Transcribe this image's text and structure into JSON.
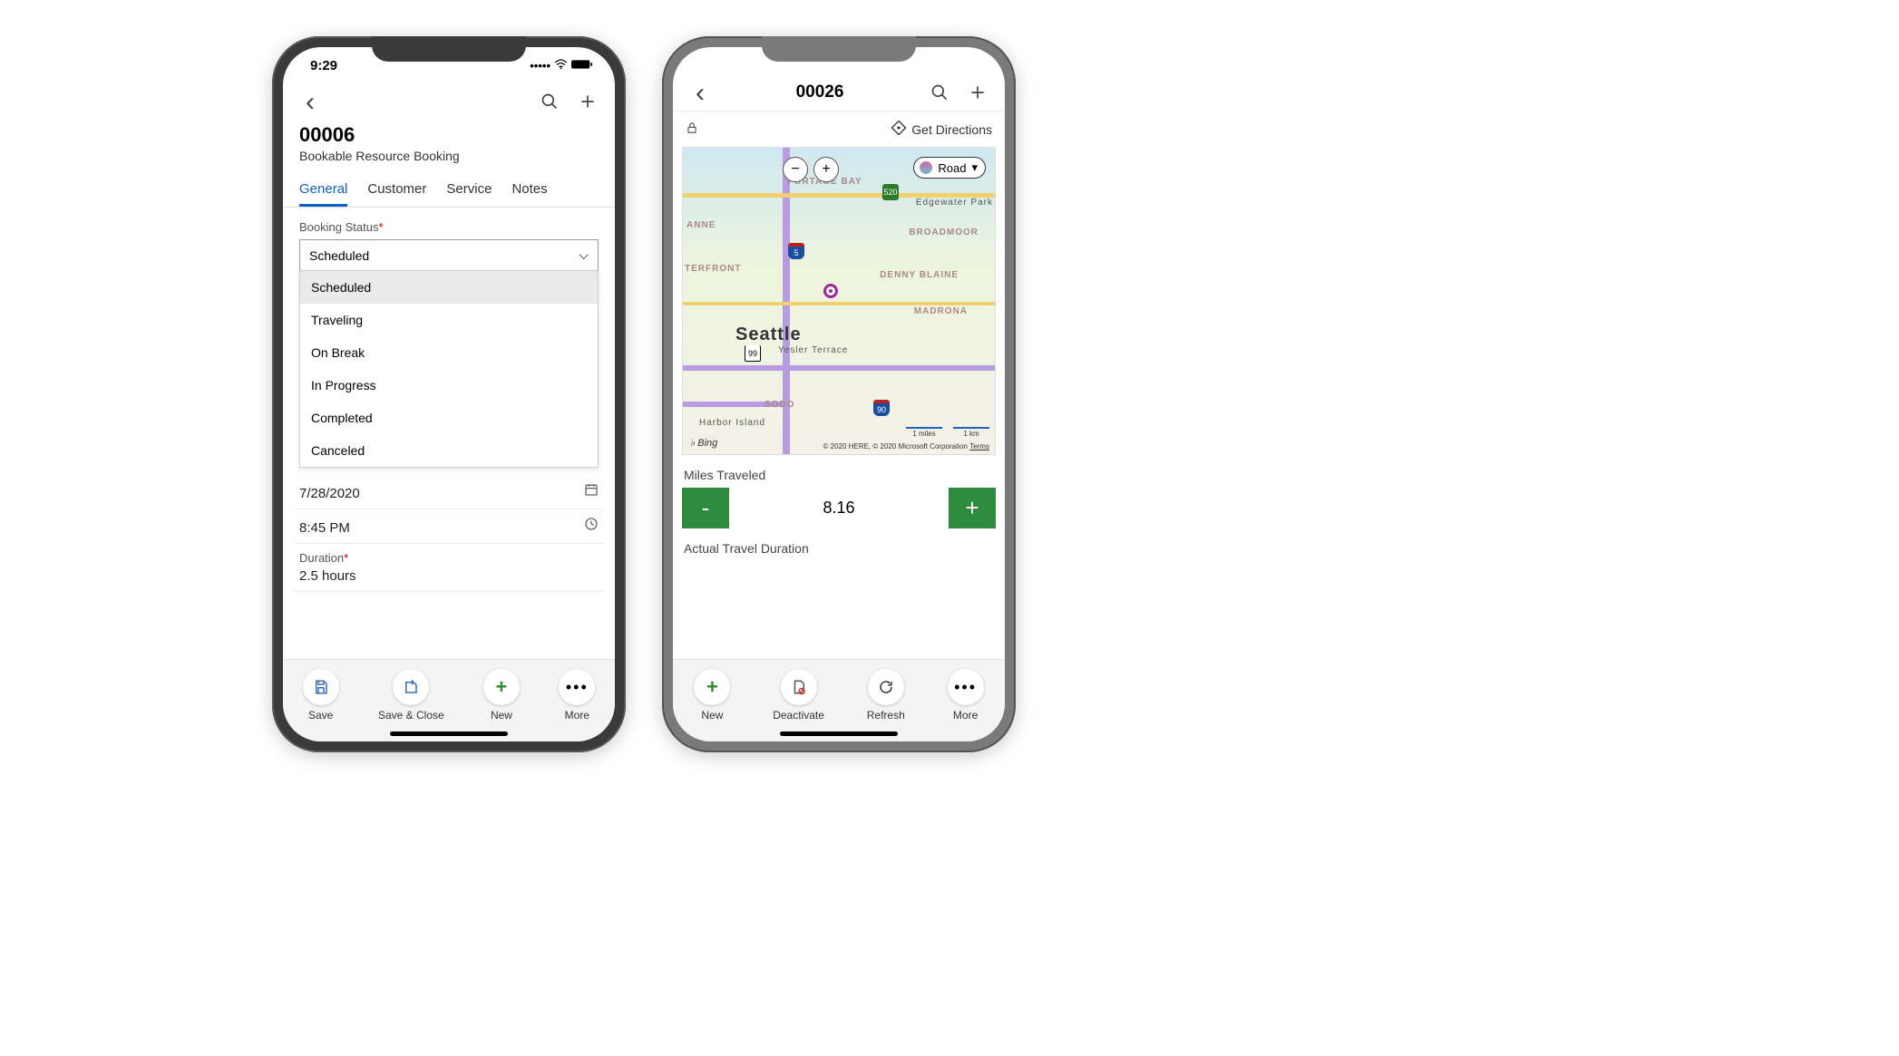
{
  "phone1": {
    "status_time": "9:29",
    "nav": {},
    "title": "00006",
    "subtitle": "Bookable Resource Booking",
    "tabs": [
      "General",
      "Customer",
      "Service",
      "Notes"
    ],
    "active_tab": "General",
    "booking_status_label": "Booking Status",
    "booking_status_value": "Scheduled",
    "booking_status_options": [
      "Scheduled",
      "Traveling",
      "On Break",
      "In Progress",
      "Completed",
      "Canceled"
    ],
    "date_value": "7/28/2020",
    "time_value": "8:45 PM",
    "duration_label": "Duration",
    "duration_value": "2.5 hours",
    "bottom": {
      "save": "Save",
      "save_close": "Save & Close",
      "new": "New",
      "more": "More"
    }
  },
  "phone2": {
    "nav_title": "00026",
    "get_directions": "Get Directions",
    "map": {
      "zoom_in": "+",
      "zoom_out": "−",
      "type_label": "Road",
      "city": "Seattle",
      "neighborhoods": {
        "portage": "PORTAGE BAY",
        "edgewater": "Edgewater Park",
        "broadmoor": "BROADMOOR",
        "denny": "DENNY BLAINE",
        "madrona": "MADRONA",
        "yesler": "Yesler Terrace",
        "sodo": "SODO",
        "anne": "ANNE",
        "terfront": "TERFRONT",
        "harbor": "Harbor Island"
      },
      "shields": {
        "i5": "5",
        "sr99": "99",
        "sr520": "520",
        "i90": "90"
      },
      "scale_miles": "1 miles",
      "scale_km": "1 km",
      "bing": "Bing",
      "attrib1": "© 2020 HERE, © 2020 Microsoft Corporation",
      "attrib_terms": "Terms"
    },
    "miles_label": "Miles Traveled",
    "miles_value": "8.16",
    "atd_label": "Actual Travel Duration",
    "bottom": {
      "new": "New",
      "deactivate": "Deactivate",
      "refresh": "Refresh",
      "more": "More"
    }
  }
}
